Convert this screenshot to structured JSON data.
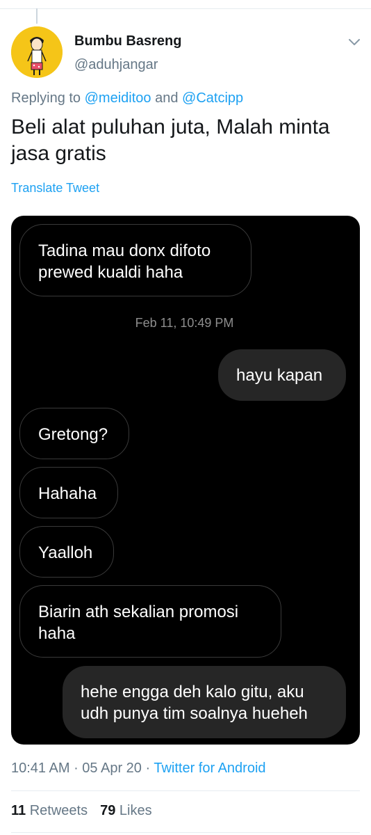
{
  "tweet": {
    "display_name": "Bumbu Basreng",
    "handle": "@aduhjangar",
    "replying_prefix": "Replying to",
    "reply_mention_1": "@meiditoo",
    "reply_and": "and",
    "reply_mention_2": "@Catcipp",
    "text": "Beli alat puluhan juta, Malah minta jasa gratis",
    "translate_label": "Translate Tweet",
    "time": "10:41 AM",
    "date": "05 Apr 20",
    "source": "Twitter for Android",
    "retweets_count": "11",
    "retweets_label": "Retweets",
    "likes_count": "79",
    "likes_label": "Likes"
  },
  "screenshot_chat": {
    "messages": [
      {
        "direction": "incoming",
        "text": "Tadina mau donx difoto prewed kualdi haha"
      },
      {
        "direction": "outgoing",
        "text": "hayu kapan"
      },
      {
        "direction": "incoming",
        "text": "Gretong?"
      },
      {
        "direction": "incoming",
        "text": "Hahaha"
      },
      {
        "direction": "incoming",
        "text": "Yaalloh"
      },
      {
        "direction": "incoming",
        "text": "Biarin ath sekalian promosi haha"
      },
      {
        "direction": "outgoing",
        "text": "hehe engga deh kalo gitu, aku udh punya tim soalnya hueheh"
      }
    ],
    "timestamp": "Feb 11, 10:49 PM"
  },
  "icons": {
    "avatar": "cartoon-person-avatar",
    "menu": "chevron-down-icon"
  },
  "colors": {
    "accent": "#1da1f2",
    "secondary_text": "#657786",
    "avatar_bg": "#f5c518",
    "chat_bg": "#000000",
    "outgoing_bubble": "#262626"
  }
}
